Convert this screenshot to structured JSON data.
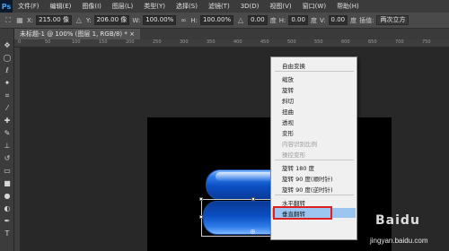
{
  "app": {
    "logo": "Ps"
  },
  "menubar": {
    "items": [
      "文件(F)",
      "编辑(E)",
      "图像(I)",
      "图层(L)",
      "类型(Y)",
      "选择(S)",
      "滤镜(T)",
      "3D(D)",
      "视图(V)",
      "窗口(W)",
      "帮助(H)"
    ]
  },
  "options_bar": {
    "x_label": "X:",
    "x_value": "215.00 像",
    "y_label": "Y:",
    "y_value": "206.00 像",
    "w_label": "W:",
    "w_value": "100.00%",
    "h_label": "H:",
    "h_value": "100.00%",
    "angle_value": "0.00",
    "angle_unit": "度",
    "hskew_label": "H:",
    "hskew_value": "0.00",
    "hskew_unit": "度",
    "vskew_label": "V:",
    "vskew_value": "0.00",
    "vskew_unit": "度",
    "interp_label": "插值:",
    "interp_value": "两次立方"
  },
  "document_tab": {
    "title": "未标题-1 @ 100% (图层 1, RGB/8) * ×"
  },
  "ruler": {
    "ticks": [
      "0",
      "50",
      "100",
      "150",
      "200",
      "250",
      "300",
      "350",
      "400",
      "450",
      "500",
      "550",
      "600",
      "650",
      "700",
      "750"
    ]
  },
  "context_menu": {
    "items": [
      {
        "label": "自由变换",
        "disabled": false
      },
      {
        "label": "缩放",
        "disabled": false
      },
      {
        "label": "旋转",
        "disabled": false
      },
      {
        "label": "斜切",
        "disabled": false
      },
      {
        "label": "扭曲",
        "disabled": false
      },
      {
        "label": "透视",
        "disabled": false
      },
      {
        "label": "变形",
        "disabled": false
      },
      {
        "label": "内容识别比例",
        "disabled": true
      },
      {
        "label": "操控变形",
        "disabled": true
      },
      {
        "label": "旋转 180 度",
        "disabled": false
      },
      {
        "label": "旋转 90 度(顺时针)",
        "disabled": false
      },
      {
        "label": "旋转 90 度(逆时针)",
        "disabled": false
      },
      {
        "label": "水平翻转",
        "disabled": false
      },
      {
        "label": "垂直翻转",
        "disabled": false
      }
    ],
    "highlighted": "垂直翻转"
  },
  "watermark": {
    "logo": "Baidu",
    "url": "jingyan.baidu.com"
  },
  "colors": {
    "highlight": "#9cc5f0",
    "annotation_box": "#e02020",
    "pill_blue": "#0b4fc4"
  }
}
